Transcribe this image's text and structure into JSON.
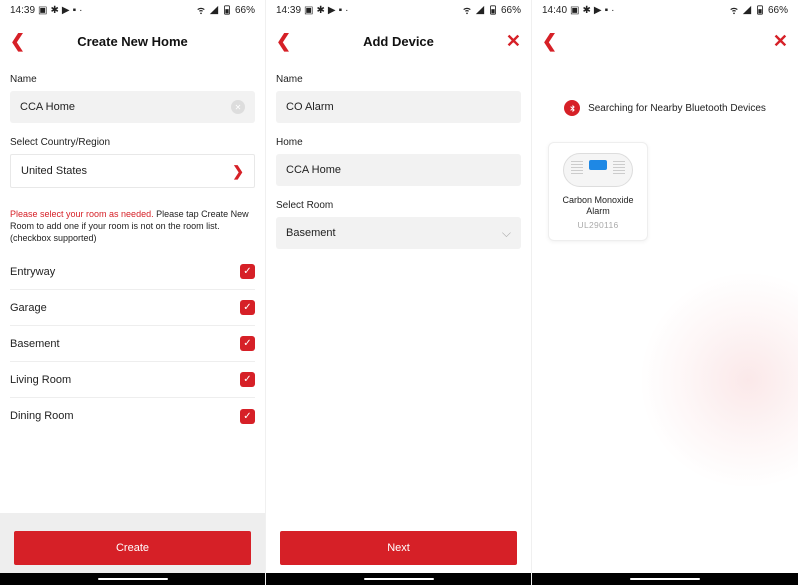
{
  "screens": [
    {
      "status": {
        "time": "14:39",
        "battery": "66%"
      },
      "header": {
        "title": "Create New Home",
        "has_back": true,
        "has_close": false
      },
      "name_label": "Name",
      "name_value": "CCA Home",
      "region_label": "Select Country/Region",
      "region_value": "United States",
      "helper_red": "Please select your room as needed.",
      "helper_rest": " Please tap Create New Room to add one if your room is not on the room list. (checkbox supported)",
      "rooms": [
        "Entryway",
        "Garage",
        "Basement",
        "Living Room",
        "Dining Room"
      ],
      "cta": "Create"
    },
    {
      "status": {
        "time": "14:39",
        "battery": "66%"
      },
      "header": {
        "title": "Add Device",
        "has_back": true,
        "has_close": true
      },
      "name_label": "Name",
      "name_value": "CO Alarm",
      "home_label": "Home",
      "home_value": "CCA Home",
      "room_label": "Select Room",
      "room_value": "Basement",
      "cta": "Next"
    },
    {
      "status": {
        "time": "14:40",
        "battery": "66%"
      },
      "header": {
        "title": "",
        "has_back": true,
        "has_close": true
      },
      "bt_text": "Searching for Nearby Bluetooth Devices",
      "card_title": "Carbon Monoxide Alarm",
      "card_sku": "UL290116"
    }
  ]
}
